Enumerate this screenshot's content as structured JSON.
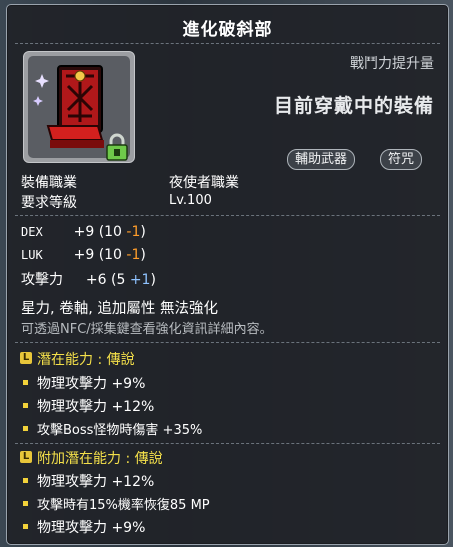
{
  "title": "進化破斜部",
  "power_label": "戰鬥力提升量",
  "equipped_text": "目前穿戴中的裝備",
  "tags": [
    "輔助武器",
    "符咒"
  ],
  "job": {
    "label": "裝備職業",
    "value": "夜使者職業"
  },
  "level": {
    "label": "要求等級",
    "value": "Lv.100"
  },
  "stats": [
    {
      "name": "DEX",
      "main": "+9",
      "base": "(10",
      "mod": "-1",
      "close": ")"
    },
    {
      "name": "LUK",
      "main": "+9",
      "base": "(10",
      "mod": "-1",
      "close": ")"
    },
    {
      "name": "攻擊力",
      "main": "+6",
      "base": "(5",
      "mod": "+1",
      "close": ")"
    }
  ],
  "notes": {
    "main": "星力, 卷軸, 追加屬性 無法強化",
    "hint": "可透過NFC/採集鍵查看強化資訊詳細內容。"
  },
  "potential": {
    "header": "潛在能力 : 傳說",
    "lines": [
      "物理攻擊力 +9%",
      "物理攻擊力 +12%",
      "攻擊Boss怪物時傷害 +35%"
    ]
  },
  "additional": {
    "header": "附加潛在能力 : 傳說",
    "lines": [
      "物理攻擊力 +12%",
      "攻擊時有15%機率恢復85 MP",
      "物理攻擊力 +9%"
    ]
  },
  "icon": {
    "name": "talisman-item-icon",
    "lock": "lock-icon"
  },
  "colors": {
    "orange": "#ff9d2a",
    "blue": "#8fc3ff",
    "gold": "#f4e04a"
  }
}
